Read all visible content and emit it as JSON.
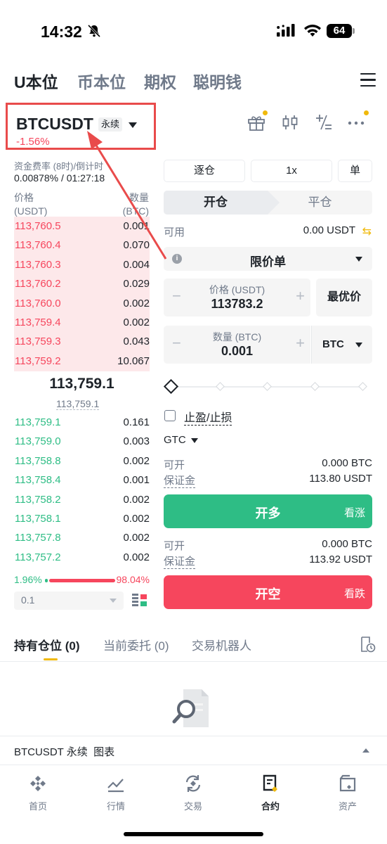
{
  "status_bar": {
    "time": "14:32",
    "battery": "64"
  },
  "top_nav": {
    "tabs": [
      "U本位",
      "币本位",
      "期权",
      "聪明钱"
    ],
    "active": 0
  },
  "symbol": {
    "name": "BTCUSDT",
    "badge": "永续",
    "change": "-1.56%"
  },
  "funding": {
    "label": "资金费率 (8时)/倒计时",
    "value": "0.00878% / 01:27:18"
  },
  "orderbook": {
    "price_header": [
      "价格",
      "(USDT)"
    ],
    "qty_header": [
      "数量",
      "(BTC)"
    ],
    "asks": [
      {
        "price": "113,760.5",
        "qty": "0.001"
      },
      {
        "price": "113,760.4",
        "qty": "0.070"
      },
      {
        "price": "113,760.3",
        "qty": "0.004"
      },
      {
        "price": "113,760.2",
        "qty": "0.029"
      },
      {
        "price": "113,760.0",
        "qty": "0.002"
      },
      {
        "price": "113,759.4",
        "qty": "0.002"
      },
      {
        "price": "113,759.3",
        "qty": "0.043"
      },
      {
        "price": "113,759.2",
        "qty": "10.067"
      }
    ],
    "last_price": "113,759.1",
    "mark_price": "113,759.1",
    "bids": [
      {
        "price": "113,759.1",
        "qty": "0.161"
      },
      {
        "price": "113,759.0",
        "qty": "0.003"
      },
      {
        "price": "113,758.8",
        "qty": "0.002"
      },
      {
        "price": "113,758.4",
        "qty": "0.001"
      },
      {
        "price": "113,758.2",
        "qty": "0.002"
      },
      {
        "price": "113,758.1",
        "qty": "0.002"
      },
      {
        "price": "113,757.8",
        "qty": "0.002"
      },
      {
        "price": "113,757.2",
        "qty": "0.002"
      }
    ],
    "buy_ratio": "1.96%",
    "sell_ratio": "98.04%",
    "depth": "0.1"
  },
  "order_form": {
    "margin_mode": "逐仓",
    "leverage": "1x",
    "position_mode": "单",
    "open_tab": "开仓",
    "close_tab": "平仓",
    "available_label": "可用",
    "available_value": "0.00 USDT",
    "order_type": "限价单",
    "price_label": "价格 (USDT)",
    "price_value": "113783.2",
    "best_price": "最优价",
    "qty_label": "数量 (BTC)",
    "qty_value": "0.001",
    "qty_unit": "BTC",
    "tpsl_label": "止盈/止损",
    "tif": "GTC",
    "long": {
      "can_open_label": "可开",
      "can_open_value": "0.000 BTC",
      "margin_label": "保证金",
      "margin_value": "113.80 USDT",
      "button": "开多",
      "sub": "看涨"
    },
    "short": {
      "can_open_label": "可开",
      "can_open_value": "0.000 BTC",
      "margin_label": "保证金",
      "margin_value": "113.92 USDT",
      "button": "开空",
      "sub": "看跌"
    }
  },
  "positions": {
    "tabs": [
      "持有仓位 (0)",
      "当前委托 (0)",
      "交易机器人"
    ]
  },
  "chart_bar": {
    "label": "BTCUSDT 永续  图表"
  },
  "bottom_nav": {
    "items": [
      "首页",
      "行情",
      "交易",
      "合约",
      "资产"
    ],
    "active": 3
  },
  "colors": {
    "up": "#2ebd85",
    "down": "#f6465d",
    "accent": "#f0b90b",
    "annotation": "#e94b4b"
  }
}
